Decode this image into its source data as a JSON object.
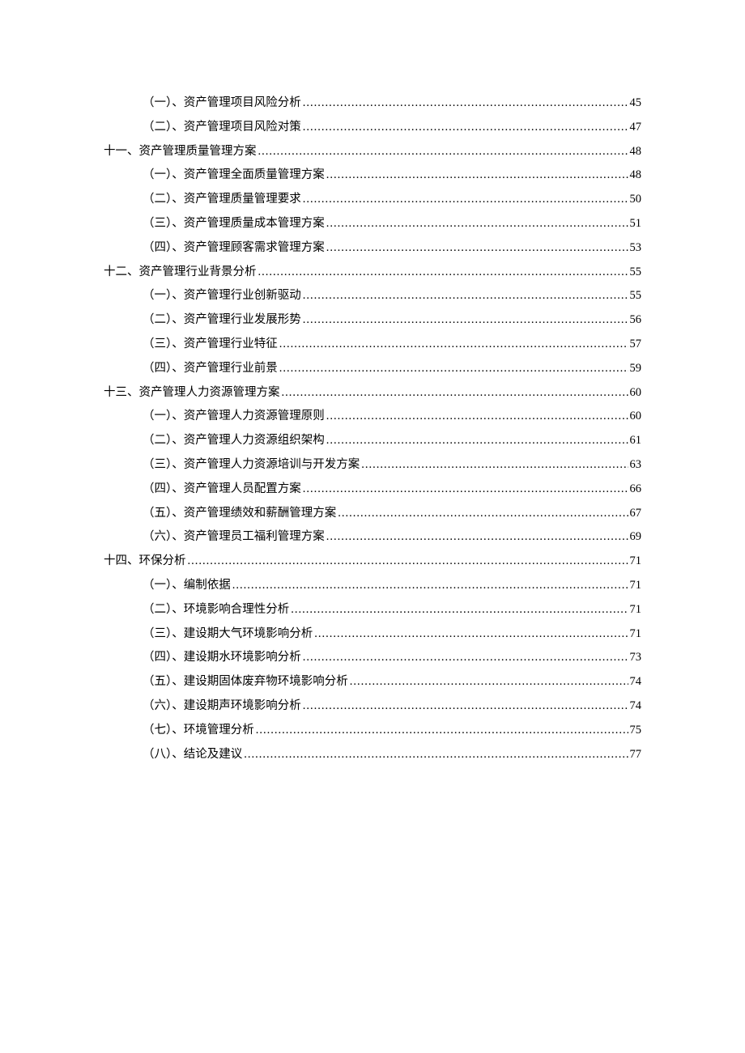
{
  "toc": [
    {
      "level": 2,
      "label": "（一）、资产管理项目风险分析",
      "page": "45"
    },
    {
      "level": 2,
      "label": "（二）、资产管理项目风险对策",
      "page": "47"
    },
    {
      "level": 1,
      "label": "十一、资产管理质量管理方案",
      "page": "48"
    },
    {
      "level": 2,
      "label": "（一）、资产管理全面质量管理方案",
      "page": "48"
    },
    {
      "level": 2,
      "label": "（二）、资产管理质量管理要求",
      "page": "50"
    },
    {
      "level": 2,
      "label": "（三）、资产管理质量成本管理方案",
      "page": "51"
    },
    {
      "level": 2,
      "label": "（四）、资产管理顾客需求管理方案",
      "page": "53"
    },
    {
      "level": 1,
      "label": "十二、资产管理行业背景分析",
      "page": "55"
    },
    {
      "level": 2,
      "label": "（一）、资产管理行业创新驱动",
      "page": "55"
    },
    {
      "level": 2,
      "label": "（二）、资产管理行业发展形势",
      "page": "56"
    },
    {
      "level": 2,
      "label": "（三）、资产管理行业特征",
      "page": "57"
    },
    {
      "level": 2,
      "label": "（四）、资产管理行业前景",
      "page": "59"
    },
    {
      "level": 1,
      "label": "十三、资产管理人力资源管理方案",
      "page": "60"
    },
    {
      "level": 2,
      "label": "（一）、资产管理人力资源管理原则",
      "page": "60"
    },
    {
      "level": 2,
      "label": "（二）、资产管理人力资源组织架构",
      "page": "61"
    },
    {
      "level": 2,
      "label": "（三）、资产管理人力资源培训与开发方案",
      "page": "63"
    },
    {
      "level": 2,
      "label": "（四）、资产管理人员配置方案",
      "page": "66"
    },
    {
      "level": 2,
      "label": "（五）、资产管理绩效和薪酬管理方案",
      "page": "67"
    },
    {
      "level": 2,
      "label": "（六）、资产管理员工福利管理方案",
      "page": "69"
    },
    {
      "level": 1,
      "label": "十四、环保分析",
      "page": "71"
    },
    {
      "level": 2,
      "label": "（一）、编制依据",
      "page": "71"
    },
    {
      "level": 2,
      "label": "（二）、环境影响合理性分析",
      "page": "71"
    },
    {
      "level": 2,
      "label": "（三）、建设期大气环境影响分析",
      "page": "71"
    },
    {
      "level": 2,
      "label": "（四）、建设期水环境影响分析",
      "page": "73"
    },
    {
      "level": 2,
      "label": "（五）、建设期固体废弃物环境影响分析",
      "page": "74"
    },
    {
      "level": 2,
      "label": "（六）、建设期声环境影响分析",
      "page": "74"
    },
    {
      "level": 2,
      "label": "（七）、环境管理分析",
      "page": "75"
    },
    {
      "level": 2,
      "label": "（八）、结论及建议",
      "page": "77"
    }
  ]
}
